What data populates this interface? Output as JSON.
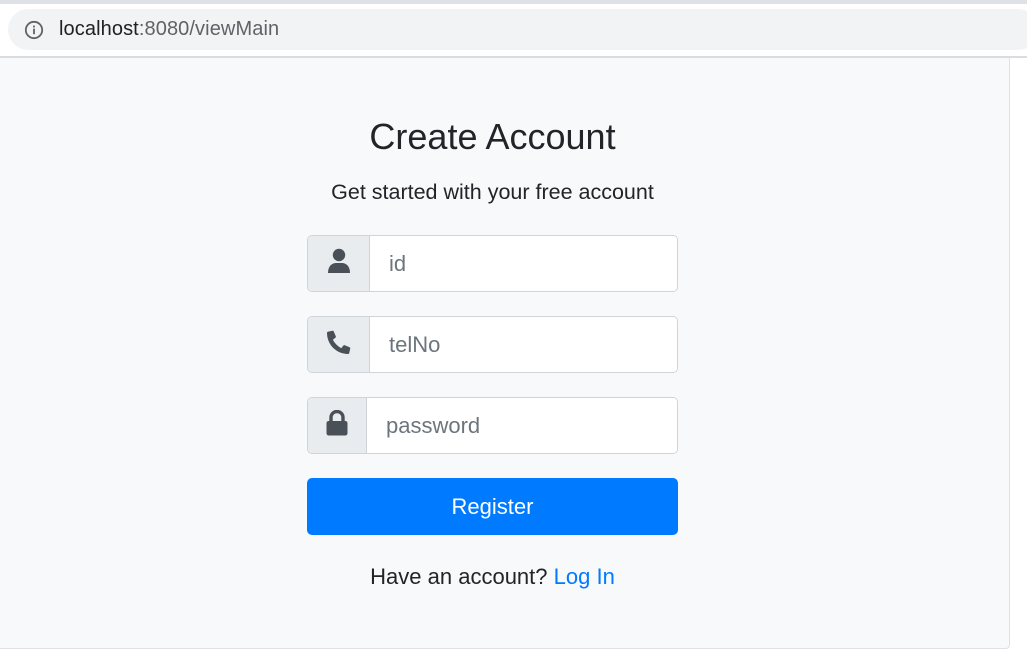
{
  "browser": {
    "url_host": "localhost",
    "url_rest": ":8080/viewMain"
  },
  "form": {
    "title": "Create Account",
    "subtitle": "Get started with your free account",
    "fields": [
      {
        "placeholder": "id",
        "icon": "user-icon"
      },
      {
        "placeholder": "telNo",
        "icon": "phone-icon"
      },
      {
        "placeholder": "password",
        "icon": "lock-icon"
      }
    ],
    "register_label": "Register",
    "login_prompt": "Have an account?",
    "login_link": "Log In"
  },
  "colors": {
    "primary": "#007bff",
    "page_background": "#f8f9fa",
    "addon_background": "#e9ecef",
    "icon": "#495057"
  }
}
